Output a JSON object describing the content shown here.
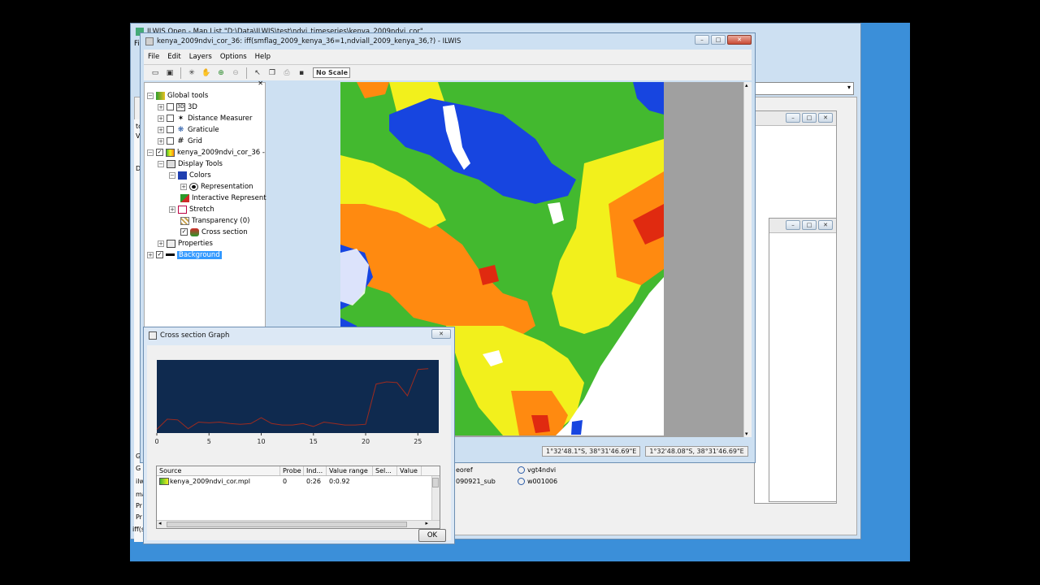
{
  "main_window": {
    "title": "ILWIS Open - Map List \"D:\\Data\\ILWIS\\test\\ndvi_timeseries\\kenya_2009ndvi_cor\"",
    "menu_letter": "Fi"
  },
  "map_window": {
    "title": "kenya_2009ndvi_cor_36: iff(smflag_2009_kenya_36=1,ndviall_2009_kenya_36,?) - ILWIS",
    "menu": [
      "File",
      "Edit",
      "Layers",
      "Options",
      "Help"
    ],
    "scale_label": "No Scale",
    "tree": {
      "global_tools": "Global tools",
      "items_3d": "3D",
      "distance": "Distance Measurer",
      "graticule": "Graticule",
      "grid": "Grid",
      "layer": "kenya_2009ndvi_cor_36 -",
      "display_tools": "Display Tools",
      "colors": "Colors",
      "representation": "Representation",
      "interactive": "Interactive Represent",
      "stretch": "Stretch",
      "transparency": "Transparency (0)",
      "cross_section": "Cross section",
      "properties": "Properties",
      "background": "Background"
    },
    "status": {
      "coord1": "1°32'48.1\"S, 38°31'46.69\"E",
      "coord2": "1°32'48.08\"S, 38°31'46.69\"E"
    },
    "colors": {
      "blue": "#1745e0",
      "green": "#43b92f",
      "yellow": "#f2f01c",
      "orange": "#ff8a10",
      "red": "#e02a10",
      "white": "#ffffff"
    }
  },
  "background_list": {
    "items_col1": [
      "eoref",
      "090921_sub"
    ],
    "items_col2": [
      "vgt4ndvi",
      "w001006"
    ]
  },
  "left_fragments": [
    "to",
    "VS",
    "D:",
    "G",
    "G",
    "ilw",
    "ma",
    "Pr",
    "Pr",
    "iff(s"
  ],
  "cross_section": {
    "title": "Cross section Graph",
    "chart_data": {
      "type": "line",
      "x": [
        0,
        1,
        2,
        3,
        4,
        5,
        6,
        7,
        8,
        9,
        10,
        11,
        12,
        13,
        14,
        15,
        16,
        17,
        18,
        19,
        20,
        21,
        22,
        23,
        24,
        25,
        26
      ],
      "series": [
        {
          "values": [
            0.05,
            0.19,
            0.18,
            0.06,
            0.15,
            0.14,
            0.15,
            0.13,
            0.12,
            0.13,
            0.21,
            0.13,
            0.11,
            0.11,
            0.13,
            0.09,
            0.15,
            0.13,
            0.11,
            0.11,
            0.12,
            0.67,
            0.7,
            0.69,
            0.51,
            0.87,
            0.88
          ]
        }
      ],
      "xticks": [
        "0",
        "5",
        "10",
        "15",
        "20",
        "25"
      ],
      "xlim": [
        0,
        27
      ],
      "ylim": [
        0,
        1
      ],
      "line_color": "#9e2b1f",
      "bg_color": "#0f2a4f"
    },
    "table": {
      "headers": [
        "Source",
        "Probe",
        "Ind...",
        "Value range",
        "Sel...",
        "Value"
      ],
      "rows": [
        {
          "source": "kenya_2009ndvi_cor.mpl",
          "probe": "0",
          "index": "0:26",
          "range": "0:0.92",
          "sel": "",
          "value": ""
        }
      ]
    },
    "ok_label": "OK"
  }
}
